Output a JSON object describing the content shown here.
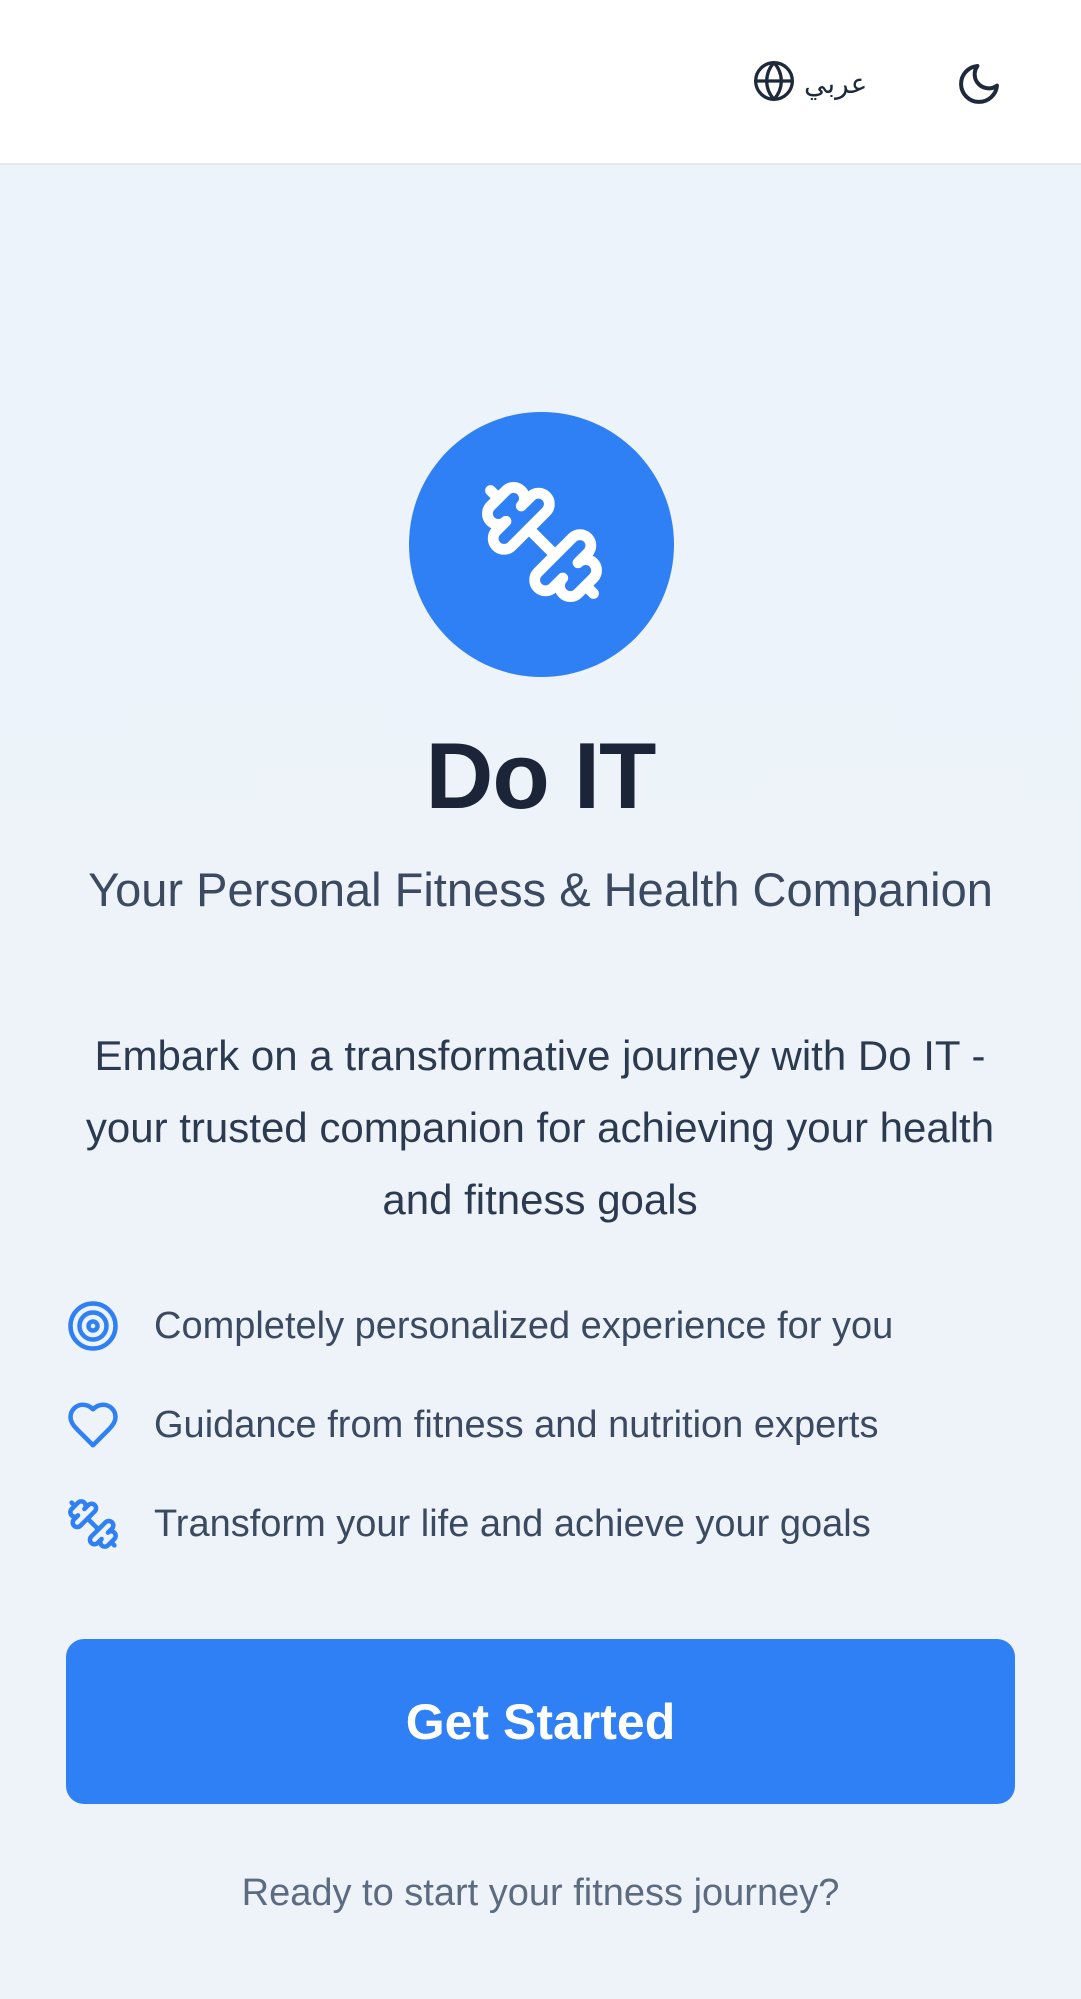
{
  "header": {
    "language_label": "عربي",
    "language_icon": "globe-icon",
    "theme_icon": "moon-icon"
  },
  "hero": {
    "icon": "dumbbell-icon",
    "title": "Do IT",
    "subtitle": "Your Personal Fitness & Health Companion",
    "description": "Embark on a transformative journey with Do IT - your trusted companion for achieving your health and fitness goals"
  },
  "features": [
    {
      "icon": "target-icon",
      "text": "Completely personalized experience for you"
    },
    {
      "icon": "heart-icon",
      "text": "Guidance from fitness and nutrition experts"
    },
    {
      "icon": "dumbbell-icon",
      "text": "Transform your life and achieve your goals"
    }
  ],
  "cta": {
    "label": "Get Started"
  },
  "footer": {
    "note": "Ready to start your fitness journey?"
  },
  "colors": {
    "accent": "#2f7ff5",
    "title": "#1b2537",
    "background": "#eef3f9"
  }
}
